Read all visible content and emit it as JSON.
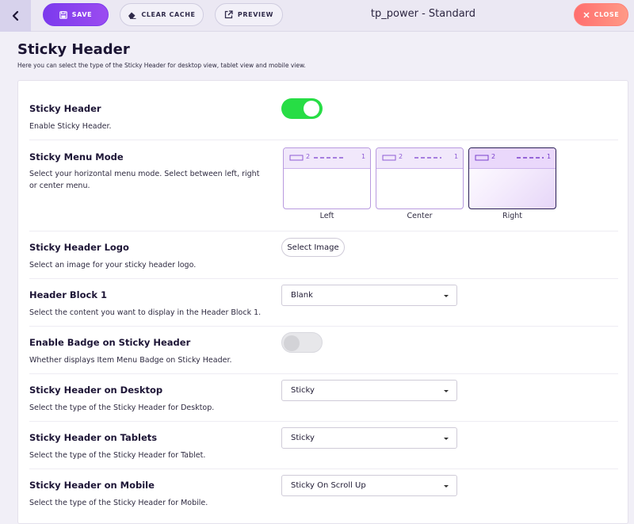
{
  "toolbar": {
    "save_label": "SAVE",
    "clear_cache_label": "CLEAR CACHE",
    "preview_label": "PREVIEW",
    "close_label": "CLOSE",
    "app_title": "tp_power - Standard"
  },
  "page": {
    "title": "Sticky Header",
    "subtitle": "Here you can select the type of the Sticky Header for desktop view, tablet view and mobile view."
  },
  "settings": {
    "sticky_header": {
      "title": "Sticky Header",
      "desc": "Enable Sticky Header.",
      "enabled": true
    },
    "menu_mode": {
      "title": "Sticky Menu Mode",
      "desc": "Select your horizontal menu mode. Select between left, right or center menu.",
      "options": [
        {
          "label": "Left",
          "left_num": "2",
          "right_num": "1"
        },
        {
          "label": "Center",
          "left_num": "2",
          "right_num": "1"
        },
        {
          "label": "Right",
          "left_num": "2",
          "right_num": "1"
        }
      ],
      "selected": "Right"
    },
    "logo": {
      "title": "Sticky Header Logo",
      "desc": "Select an image for your sticky header logo.",
      "button_label": "Select Image"
    },
    "header_block": {
      "title": "Header Block 1",
      "desc": "Select the content you want to display in the Header Block 1.",
      "value": "Blank"
    },
    "badge": {
      "title": "Enable Badge on Sticky Header",
      "desc": "Whether displays Item Menu Badge on Sticky Header.",
      "enabled": false
    },
    "desktop": {
      "title": "Sticky Header on Desktop",
      "desc": "Select the type of the Sticky Header for Desktop.",
      "value": "Sticky"
    },
    "tablet": {
      "title": "Sticky Header on Tablets",
      "desc": "Select the type of the Sticky Header for Tablet.",
      "value": "Sticky"
    },
    "mobile": {
      "title": "Sticky Header on Mobile",
      "desc": "Select the type of the Sticky Header for Mobile.",
      "value": "Sticky On Scroll Up"
    }
  },
  "icons": {
    "back": "chevron-left-icon",
    "save": "floppy-disk-icon",
    "clear_cache": "eraser-icon",
    "preview": "external-link-icon",
    "close": "x-icon",
    "dropdown": "caret-down-icon"
  },
  "colors": {
    "accent": "#7c3aed",
    "toggle_on": "#27dd45",
    "close": "#ff7a72",
    "background": "#f1eff7"
  }
}
